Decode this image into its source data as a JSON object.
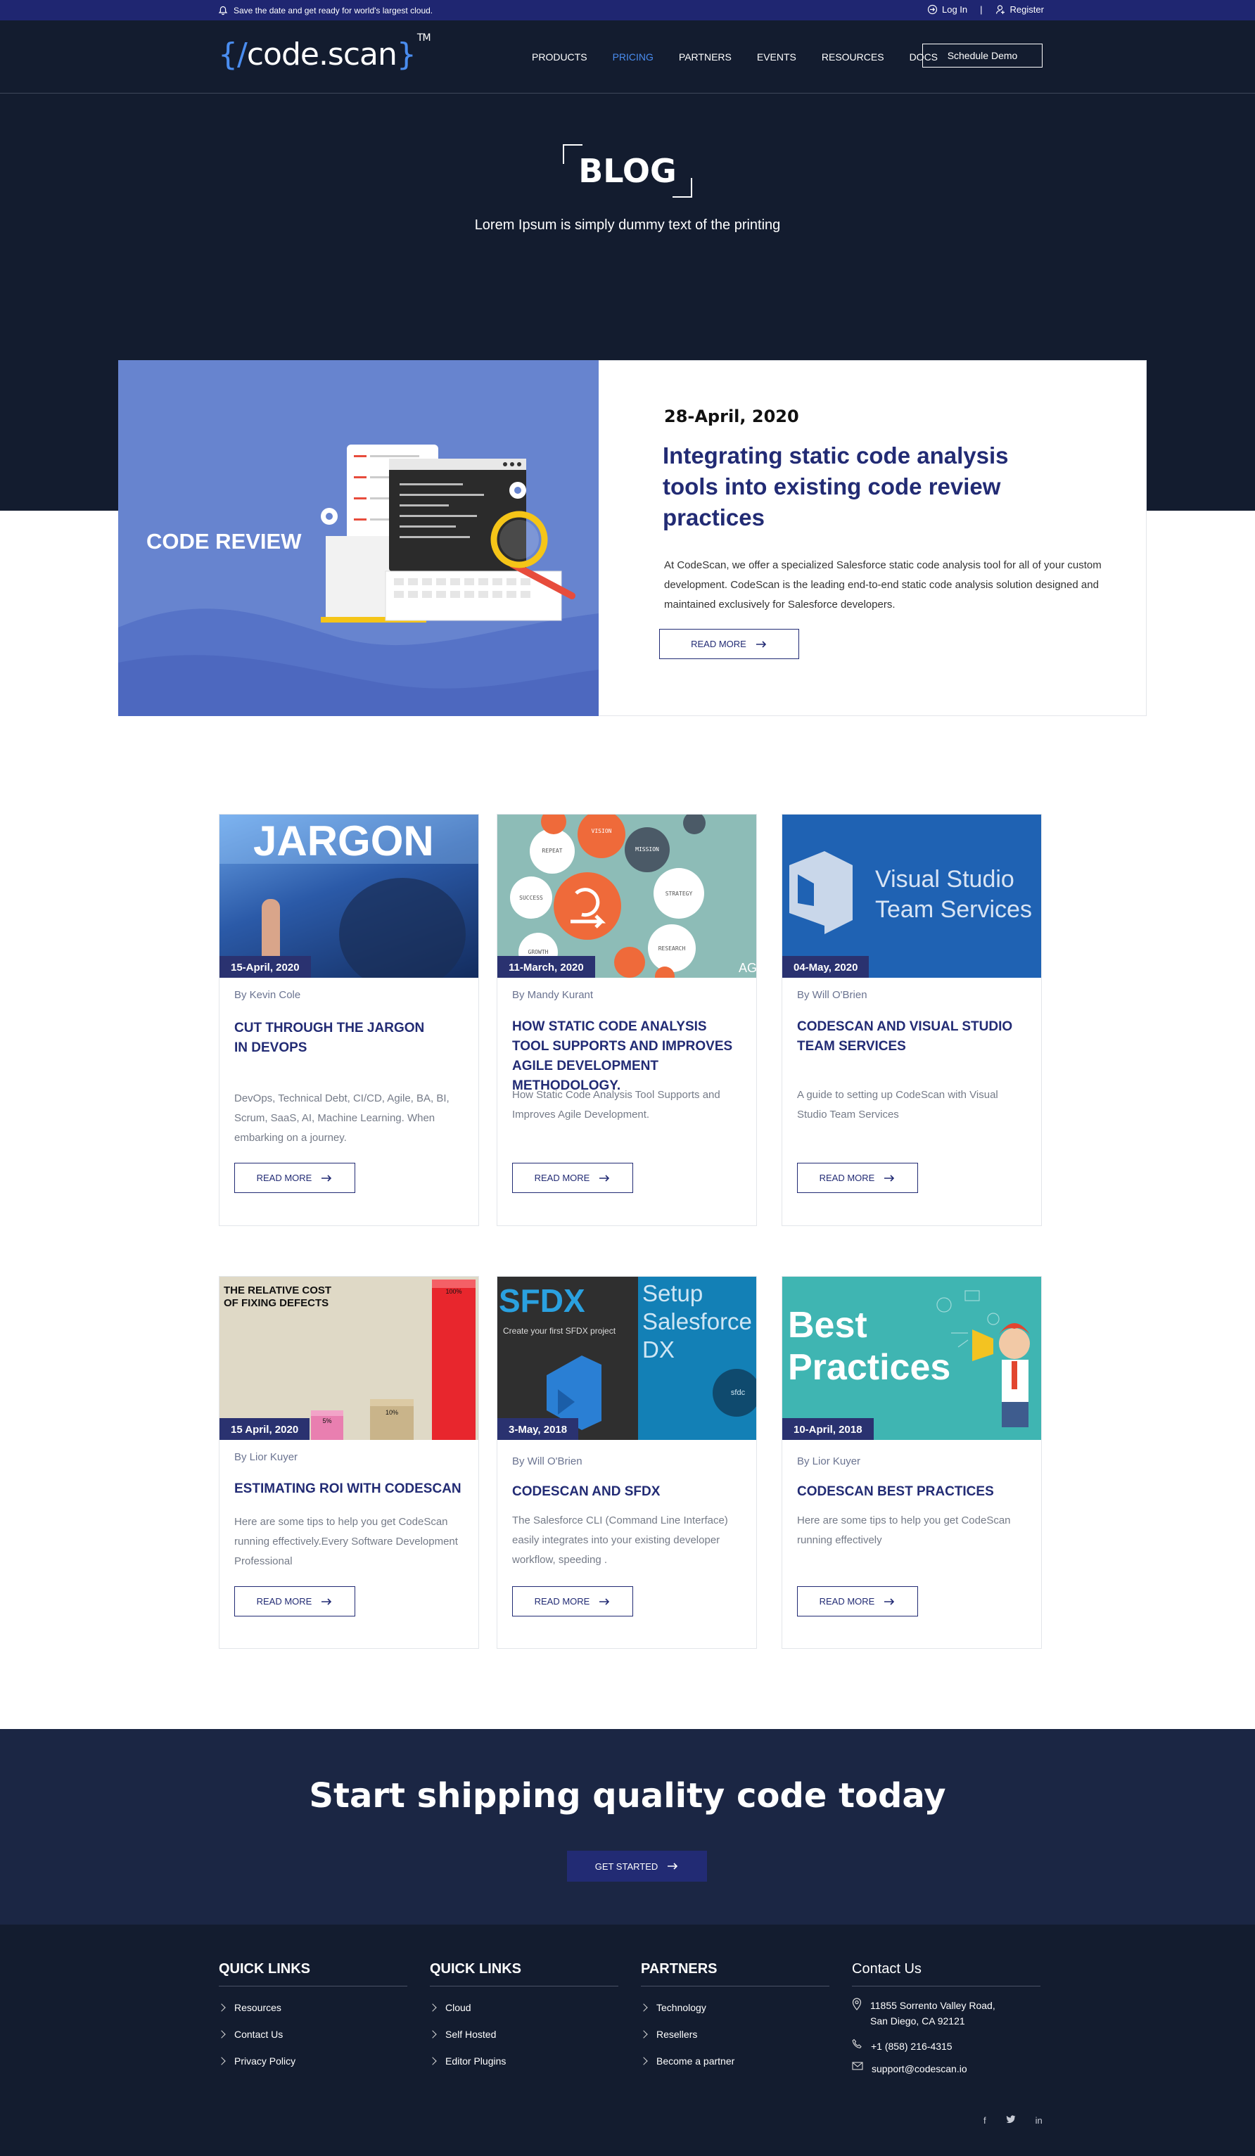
{
  "topbar": {
    "notice": "Save the date and get ready for world's largest cloud.",
    "login": "Log In",
    "separator": "|",
    "register": "Register"
  },
  "header": {
    "logo_open": "{/",
    "logo_text": "code.scan",
    "logo_close": "}",
    "logo_tm": "TM",
    "nav": [
      "PRODUCTS",
      "PRICING",
      "PARTNERS",
      "EVENTS",
      "RESOURCES",
      "DOCS"
    ],
    "active_nav": "PRICING",
    "demo_button": "Schedule Demo"
  },
  "hero": {
    "title": "BLOG",
    "subtitle": "Lorem Ipsum is simply dummy text of the printing"
  },
  "featured": {
    "image_label": "CODE REVIEW",
    "date": "28-April, 2020",
    "title": "Integrating static code analysis tools into existing code review practices",
    "description": "At CodeScan, we offer a specialized Salesforce static code analysis tool for all of your custom development. CodeScan is the leading end-to-end static code analysis solution designed and maintained exclusively for Salesforce developers.",
    "button": "READ MORE"
  },
  "cards": [
    {
      "thumb_text": "JARGON",
      "date": "15-April, 2020",
      "author": "By Kevin Cole",
      "title": "CUT THROUGH THE JARGON IN DEVOPS",
      "desc": "DevOps, Technical Debt, CI/CD, Agile, BA, BI, Scrum, SaaS, AI, Machine Learning. When embarking on a journey.",
      "button": "READ MORE"
    },
    {
      "thumb_words": [
        "VISION",
        "REPEAT",
        "MISSION",
        "SUCCESS",
        "STRATEGY",
        "GROWTH",
        "RESEARCH",
        "AG"
      ],
      "date": "11-March, 2020",
      "author": "By Mandy Kurant",
      "title": "HOW STATIC CODE ANALYSIS TOOL SUPPORTS AND IMPROVES AGILE DEVELOPMENT METHODOLOGY.",
      "desc": "How Static Code Analysis Tool Supports and Improves Agile Development.",
      "button": "READ MORE"
    },
    {
      "thumb_line1": "Visual Studio",
      "thumb_line2": "Team Services",
      "date": "04-May, 2020",
      "author": "By Will O'Brien",
      "title": "CODESCAN AND VISUAL STUDIO TEAM SERVICES",
      "desc": "A guide to setting up CodeScan with Visual Studio Team Services",
      "button": "READ MORE"
    },
    {
      "thumb_line1": "THE RELATIVE COST",
      "thumb_line2": "OF FIXING DEFECTS",
      "bars": [
        {
          "label": "5%",
          "value": 5
        },
        {
          "label": "10%",
          "value": 10
        },
        {
          "label": "100%",
          "value": 100
        }
      ],
      "date": "15 April, 2020",
      "author": "By Lior Kuyer",
      "title": "ESTIMATING ROI WITH CODESCAN",
      "desc": "Here are some tips to help you get CodeScan running effectively.Every Software Development Professional",
      "button": "READ MORE"
    },
    {
      "thumb_title": "SFDX",
      "thumb_sub": "Create your first SFDX project",
      "thumb_right": "Setup Salesforce DX",
      "thumb_badge": "sfdc",
      "date": "3-May, 2018",
      "author": "By Will O'Brien",
      "title": "CODESCAN AND SFDX",
      "desc": "The Salesforce CLI (Command Line Interface) easily integrates into your existing developer workflow, speeding .",
      "button": "READ MORE"
    },
    {
      "thumb_line1": "Best",
      "thumb_line2": "Practices",
      "date": "10-April, 2018",
      "author": "By Lior Kuyer",
      "title": "CODESCAN BEST PRACTICES",
      "desc": "Here are some tips to help you get CodeScan running effectively",
      "button": "READ MORE"
    }
  ],
  "cta": {
    "title": "Start shipping quality code today",
    "button": "GET STARTED"
  },
  "footer": {
    "col1": {
      "title": "QUICK LINKS",
      "links": [
        "Resources",
        "Contact Us",
        "Privacy Policy"
      ]
    },
    "col2": {
      "title": "QUICK LINKS",
      "links": [
        "Cloud",
        "Self Hosted",
        "Editor Plugins"
      ]
    },
    "col3": {
      "title": "PARTNERS",
      "links": [
        "Technology",
        "Resellers",
        "Become a partner"
      ]
    },
    "col4": {
      "title": "Contact Us",
      "address_line1": "11855 Sorrento Valley Road,",
      "address_line2": "San Diego, CA 92121",
      "phone": "+1 (858) 216-4315",
      "email": "support@codescan.io"
    },
    "social": [
      "f",
      "t",
      "in"
    ]
  },
  "colors": {
    "navy": "#131c2f",
    "brand": "#222b74",
    "accent": "#4a8df0",
    "topbar": "#1f2671"
  }
}
